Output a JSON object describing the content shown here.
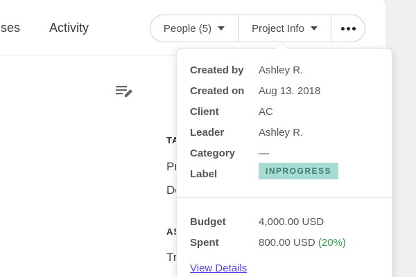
{
  "nav": {
    "tab_expenses": "nses",
    "tab_activity": "Activity"
  },
  "toolbar": {
    "people_label": "People (5)",
    "project_info_label": "Project Info"
  },
  "background": {
    "section_1_partial": "TA",
    "row_1_partial": "Pr",
    "row_2_partial": "De",
    "section_2_partial": "AS",
    "row_3_partial": "Tr"
  },
  "project_info": {
    "created_by_label": "Created by",
    "created_by_value": "Ashley R.",
    "created_on_label": "Created on",
    "created_on_value": "Aug 13. 2018",
    "client_label": "Client",
    "client_value": "AC",
    "leader_label": "Leader",
    "leader_value": "Ashley R.",
    "category_label": "Category",
    "category_value": "—",
    "label_label": "Label",
    "label_value": "INPROGRESS",
    "budget_label": "Budget",
    "budget_value": "4,000.00 USD",
    "spent_label": "Spent",
    "spent_value": "800.00 USD",
    "spent_percent": "(20%)",
    "view_details": "View Details"
  }
}
